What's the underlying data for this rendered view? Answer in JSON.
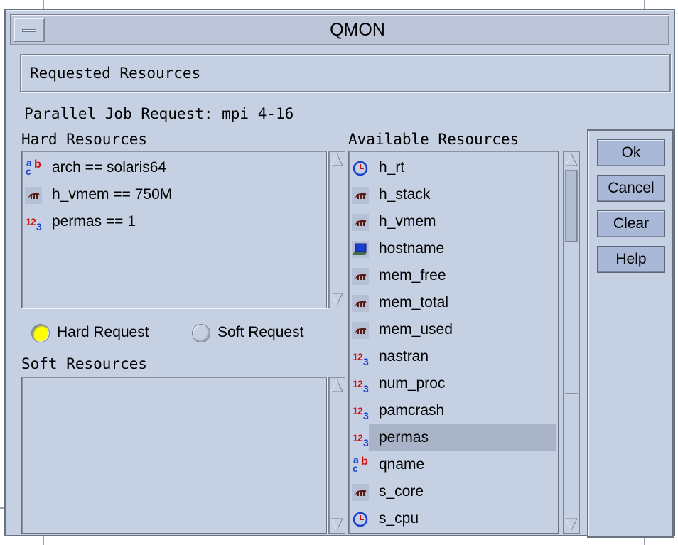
{
  "window": {
    "title": "QMON",
    "header": "Requested Resources",
    "parallel_request": "Parallel Job Request: mpi 4-16"
  },
  "hard": {
    "label": "Hard Resources",
    "items": [
      {
        "icon": "string-type-icon",
        "text": "arch == solaris64"
      },
      {
        "icon": "memory-type-icon",
        "text": "h_vmem == 750M"
      },
      {
        "icon": "integer-type-icon",
        "text": "permas == 1"
      }
    ]
  },
  "request_mode": {
    "hard_label": "Hard Request",
    "soft_label": "Soft Request",
    "selected": "hard"
  },
  "soft": {
    "label": "Soft Resources",
    "items": []
  },
  "available": {
    "label": "Available Resources",
    "selected": "permas",
    "items": [
      {
        "icon": "time-type-icon",
        "name": "h_rt"
      },
      {
        "icon": "memory-type-icon",
        "name": "h_stack"
      },
      {
        "icon": "memory-type-icon",
        "name": "h_vmem"
      },
      {
        "icon": "host-type-icon",
        "name": "hostname"
      },
      {
        "icon": "memory-type-icon",
        "name": "mem_free"
      },
      {
        "icon": "memory-type-icon",
        "name": "mem_total"
      },
      {
        "icon": "memory-type-icon",
        "name": "mem_used"
      },
      {
        "icon": "integer-type-icon",
        "name": "nastran"
      },
      {
        "icon": "integer-type-icon",
        "name": "num_proc"
      },
      {
        "icon": "integer-type-icon",
        "name": "pamcrash"
      },
      {
        "icon": "integer-type-icon",
        "name": "permas"
      },
      {
        "icon": "string-type-icon",
        "name": "qname"
      },
      {
        "icon": "memory-type-icon",
        "name": "s_core"
      },
      {
        "icon": "time-type-icon",
        "name": "s_cpu"
      }
    ]
  },
  "buttons": {
    "ok": "Ok",
    "cancel": "Cancel",
    "clear": "Clear",
    "help": "Help"
  },
  "colors": {
    "background": "#c6d0e3",
    "button": "#a9b8d7",
    "selection": "#a9b3c8",
    "radio_selected": "#ffff00"
  }
}
